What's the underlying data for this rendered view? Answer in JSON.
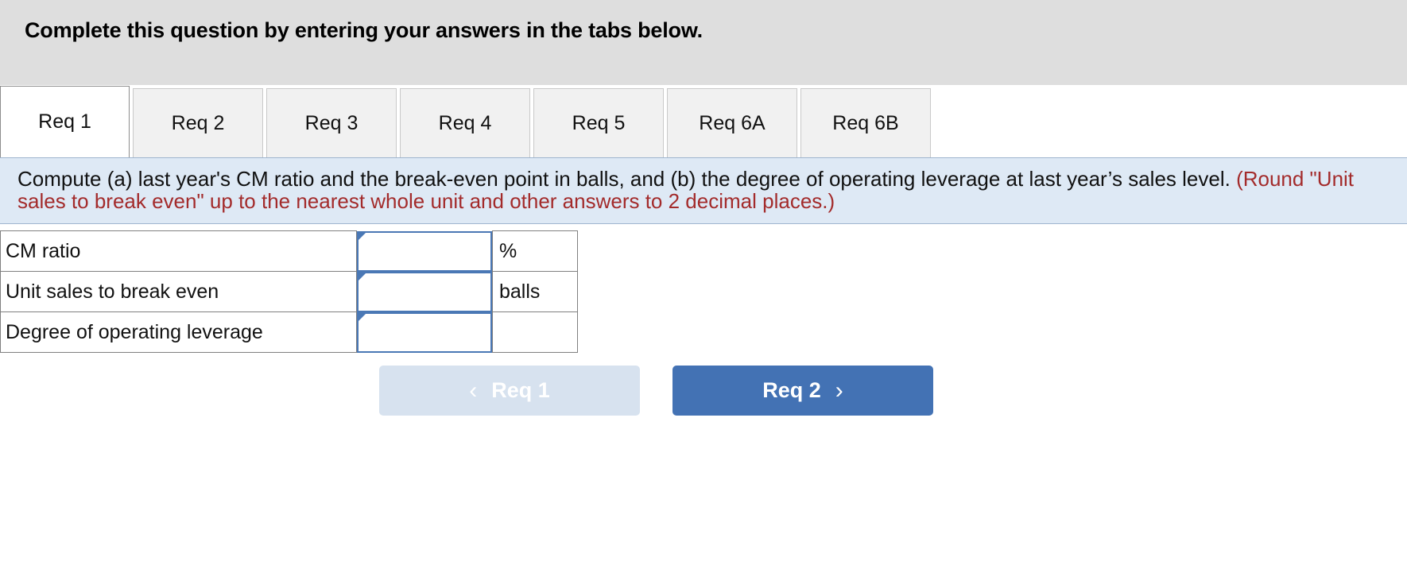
{
  "header": {
    "title": "Complete this question by entering your answers in the tabs below."
  },
  "tabs": [
    {
      "label": "Req 1",
      "active": true
    },
    {
      "label": "Req 2",
      "active": false
    },
    {
      "label": "Req 3",
      "active": false
    },
    {
      "label": "Req 4",
      "active": false
    },
    {
      "label": "Req 5",
      "active": false
    },
    {
      "label": "Req 6A",
      "active": false
    },
    {
      "label": "Req 6B",
      "active": false
    }
  ],
  "instruction": {
    "main": "Compute (a) last year's CM ratio and the break-even point in balls, and (b) the degree of operating leverage at last year’s sales level. ",
    "hint": "(Round \"Unit sales to break even\" up to the nearest whole unit and other answers to 2 decimal places.)"
  },
  "answer_table": {
    "rows": [
      {
        "label": "CM ratio",
        "value": "",
        "unit": "%"
      },
      {
        "label": "Unit sales to break even",
        "value": "",
        "unit": "balls"
      },
      {
        "label": "Degree of operating leverage",
        "value": "",
        "unit": ""
      }
    ]
  },
  "navigation": {
    "prev_label": "Req 1",
    "prev_chevron": "chevron-left-icon",
    "prev_glyph": "‹",
    "next_label": "Req 2",
    "next_chevron": "chevron-right-icon",
    "next_glyph": "›"
  },
  "colors": {
    "header_bg": "#dedede",
    "instruction_bg": "#dee9f5",
    "hint_text": "#a32b2b",
    "input_border": "#4a78b5",
    "next_button_bg": "#4372b4",
    "prev_button_bg": "#d7e2ef",
    "tab_inactive_bg": "#f1f1f1",
    "tab_active_bg": "#ffffff"
  }
}
